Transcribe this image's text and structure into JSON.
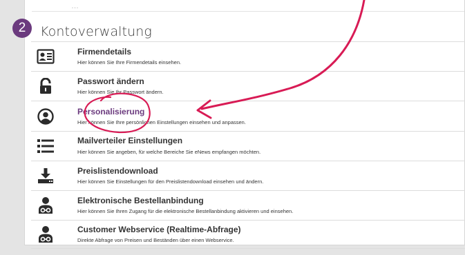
{
  "step_number": "2",
  "section_title": "Kontoverwaltung",
  "previous_row_text": "…",
  "items": [
    {
      "icon": "id-card-icon",
      "title": "Firmendetails",
      "desc": "Hier können Sie Ihre Firmendetails einsehen."
    },
    {
      "icon": "unlocked-padlock-icon",
      "title": "Passwort ändern",
      "desc": "Hier können Sie Ihr Passwort ändern."
    },
    {
      "icon": "user-circle-icon",
      "title": "Personalisierung",
      "desc": "Hier können Sie Ihre persönlichen Einstellungen einsehen und anpassen."
    },
    {
      "icon": "list-icon",
      "title": "Mailverteiler Einstellungen",
      "desc": "Hier können Sie angeben, für welche Bereiche Sie eNews empfangen möchten."
    },
    {
      "icon": "download-tray-icon",
      "title": "Preislistendownload",
      "desc": "Hier können Sie Einstellungen für den Preislistendownload einsehen und ändern."
    },
    {
      "icon": "user-link-icon",
      "title": "Elektronische Bestellanbindung",
      "desc": "Hier können Sie Ihren Zugang für die elektronische Bestellanbindung aktivieren und einsehen."
    },
    {
      "icon": "user-link-icon",
      "title": "Customer Webservice (Realtime-Abfrage)",
      "desc": "Direkte Abfrage von Preisen und Beständen über einen Webservice."
    }
  ],
  "colors": {
    "accent": "#6b3a7e",
    "annotation": "#d81b55",
    "icon": "#2b2b2b"
  }
}
